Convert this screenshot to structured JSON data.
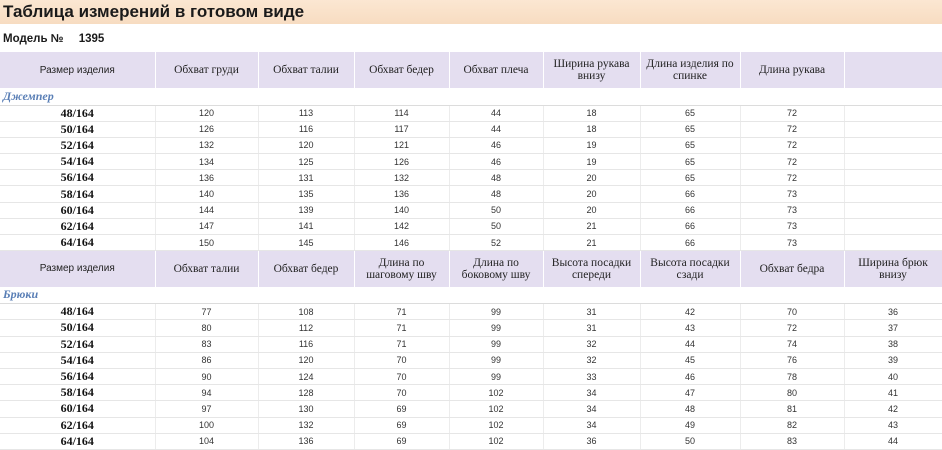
{
  "title": "Таблица измерений в готовом виде",
  "model": {
    "label": "Модель №",
    "number": "1395"
  },
  "jumper": {
    "section": "Джемпер",
    "headers": [
      "Размер изделия",
      "Обхват груди",
      "Обхват талии",
      "Обхват бедер",
      "Обхват плеча",
      "Ширина рукава внизу",
      "Длина изделия по спинке",
      "Длина рукава",
      ""
    ],
    "rows": [
      [
        "48/164",
        "120",
        "113",
        "114",
        "44",
        "18",
        "65",
        "72",
        ""
      ],
      [
        "50/164",
        "126",
        "116",
        "117",
        "44",
        "18",
        "65",
        "72",
        ""
      ],
      [
        "52/164",
        "132",
        "120",
        "121",
        "46",
        "19",
        "65",
        "72",
        ""
      ],
      [
        "54/164",
        "134",
        "125",
        "126",
        "46",
        "19",
        "65",
        "72",
        ""
      ],
      [
        "56/164",
        "136",
        "131",
        "132",
        "48",
        "20",
        "65",
        "72",
        ""
      ],
      [
        "58/164",
        "140",
        "135",
        "136",
        "48",
        "20",
        "66",
        "73",
        ""
      ],
      [
        "60/164",
        "144",
        "139",
        "140",
        "50",
        "20",
        "66",
        "73",
        ""
      ],
      [
        "62/164",
        "147",
        "141",
        "142",
        "50",
        "21",
        "66",
        "73",
        ""
      ],
      [
        "64/164",
        "150",
        "145",
        "146",
        "52",
        "21",
        "66",
        "73",
        ""
      ]
    ]
  },
  "pants": {
    "section": "Брюки",
    "headers": [
      "Размер изделия",
      "Обхват талии",
      "Обхват бедер",
      "Длина по шаговому шву",
      "Длина по боковому шву",
      "Высота посадки спереди",
      "Высота посадки сзади",
      "Обхват бедра",
      "Ширина брюк внизу"
    ],
    "rows": [
      [
        "48/164",
        "77",
        "108",
        "71",
        "99",
        "31",
        "42",
        "70",
        "36"
      ],
      [
        "50/164",
        "80",
        "112",
        "71",
        "99",
        "31",
        "43",
        "72",
        "37"
      ],
      [
        "52/164",
        "83",
        "116",
        "71",
        "99",
        "32",
        "44",
        "74",
        "38"
      ],
      [
        "54/164",
        "86",
        "120",
        "70",
        "99",
        "32",
        "45",
        "76",
        "39"
      ],
      [
        "56/164",
        "90",
        "124",
        "70",
        "99",
        "33",
        "46",
        "78",
        "40"
      ],
      [
        "58/164",
        "94",
        "128",
        "70",
        "102",
        "34",
        "47",
        "80",
        "41"
      ],
      [
        "60/164",
        "97",
        "130",
        "69",
        "102",
        "34",
        "48",
        "81",
        "42"
      ],
      [
        "62/164",
        "100",
        "132",
        "69",
        "102",
        "34",
        "49",
        "82",
        "43"
      ],
      [
        "64/164",
        "104",
        "136",
        "69",
        "102",
        "36",
        "50",
        "83",
        "44"
      ]
    ]
  }
}
